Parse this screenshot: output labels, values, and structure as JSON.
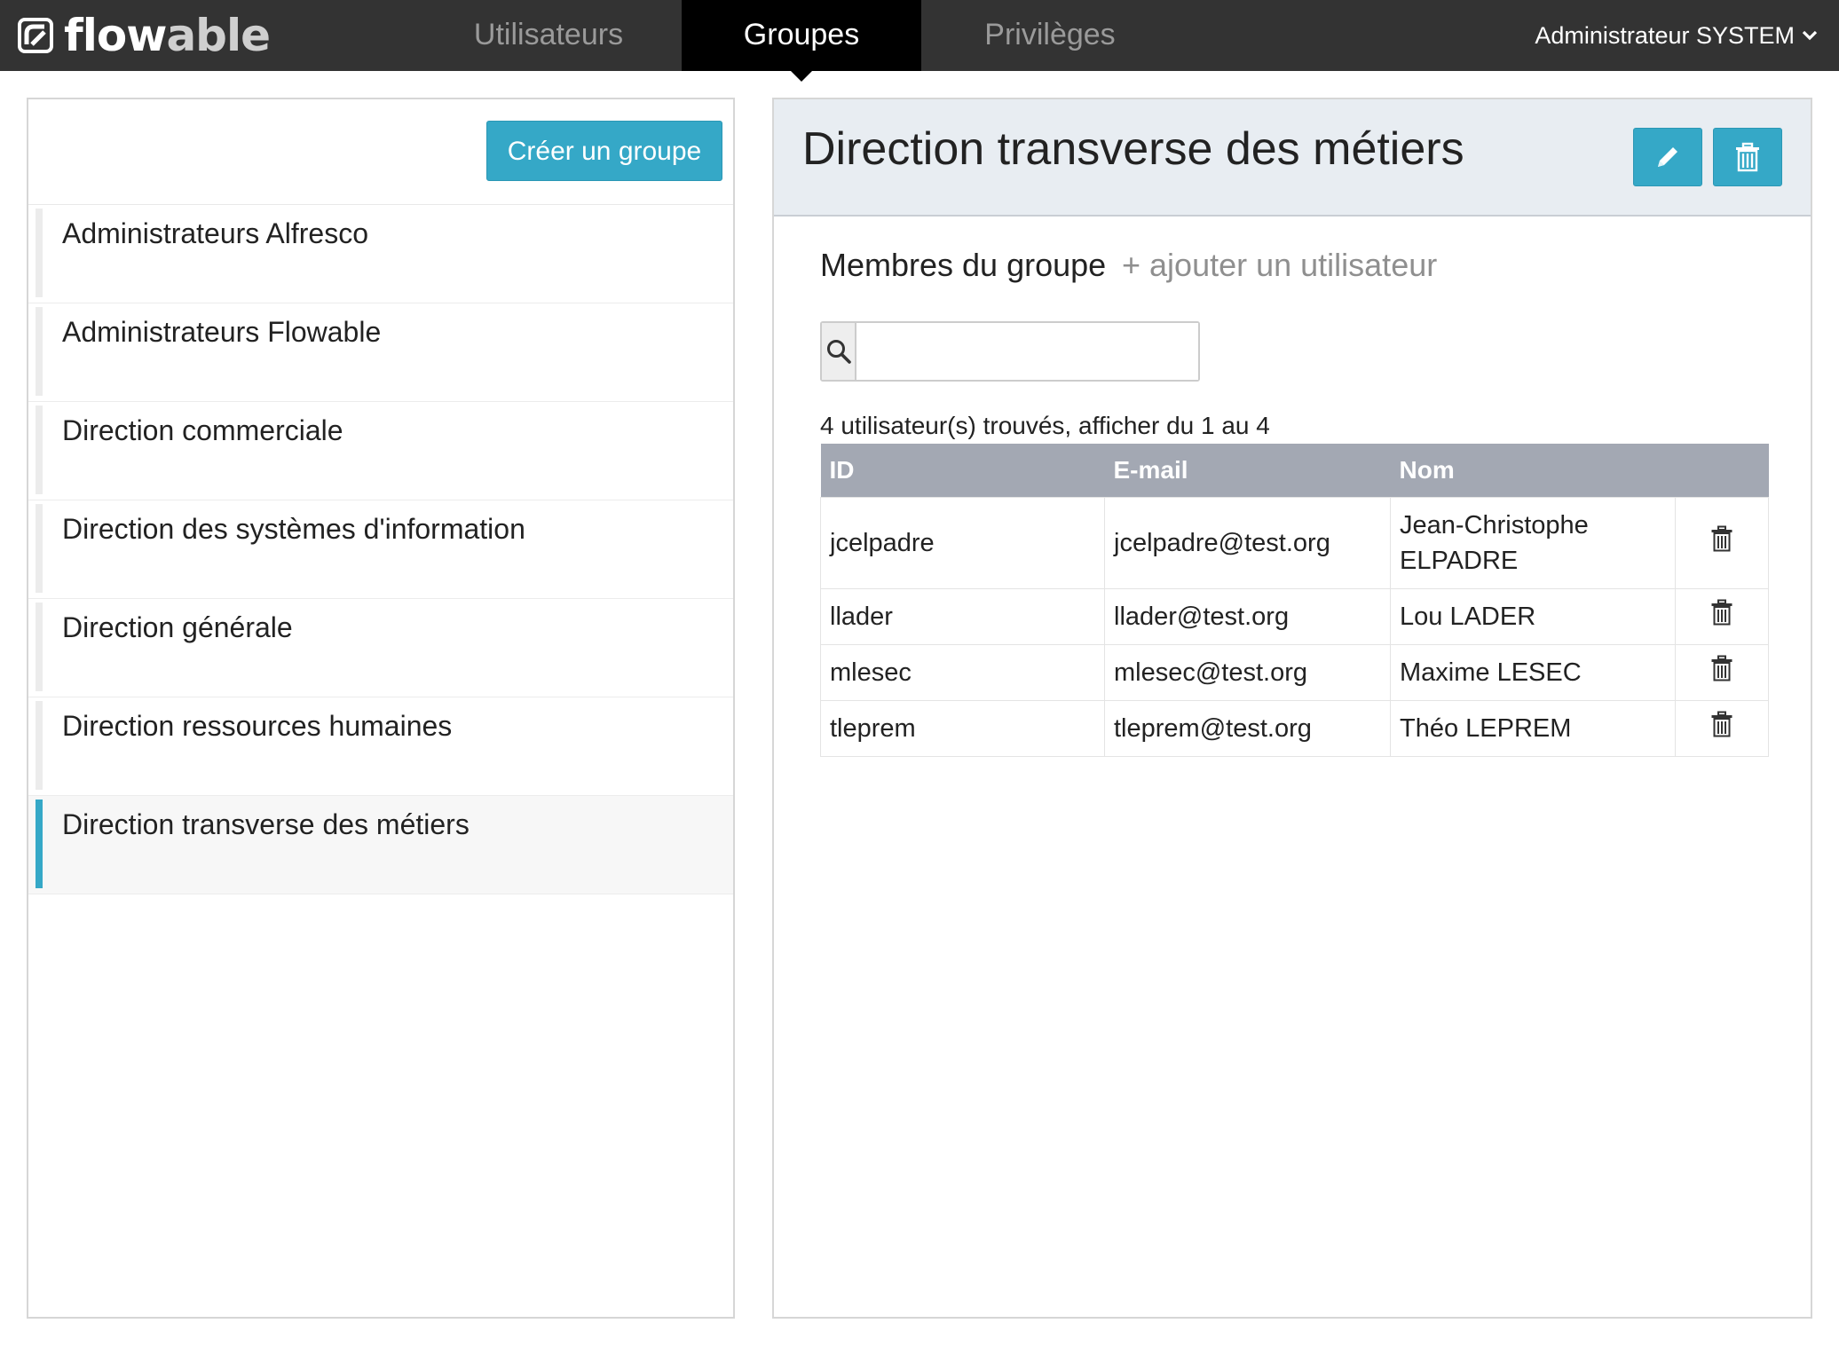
{
  "app": {
    "logo_text": "flowable"
  },
  "nav": {
    "tabs": [
      {
        "label": "Utilisateurs",
        "active": false
      },
      {
        "label": "Groupes",
        "active": true
      },
      {
        "label": "Privilèges",
        "active": false
      }
    ],
    "user_menu_label": "Administrateur SYSTEM"
  },
  "sidebar": {
    "create_button_label": "Créer un groupe",
    "groups": [
      {
        "label": "Administrateurs Alfresco",
        "active": false
      },
      {
        "label": "Administrateurs Flowable",
        "active": false
      },
      {
        "label": "Direction commerciale",
        "active": false
      },
      {
        "label": "Direction des systèmes d'information",
        "active": false
      },
      {
        "label": "Direction générale",
        "active": false
      },
      {
        "label": "Direction ressources humaines",
        "active": false
      },
      {
        "label": "Direction transverse des métiers",
        "active": true
      }
    ]
  },
  "detail": {
    "title": "Direction transverse des métiers",
    "edit_icon": "pencil-icon",
    "delete_icon": "trash-icon",
    "members_heading": "Membres du groupe",
    "add_user_label": "+ ajouter un utilisateur",
    "search": {
      "value": "",
      "icon": "search-icon"
    },
    "result_count": "4 utilisateur(s) trouvés, afficher du 1 au 4",
    "table": {
      "headers": [
        "ID",
        "E-mail",
        "Nom"
      ],
      "rows": [
        {
          "id": "jcelpadre",
          "email": "jcelpadre@test.org",
          "name": "Jean-Christophe ELPADRE"
        },
        {
          "id": "llader",
          "email": "llader@test.org",
          "name": "Lou LADER"
        },
        {
          "id": "mlesec",
          "email": "mlesec@test.org",
          "name": "Maxime LESEC"
        },
        {
          "id": "tleprem",
          "email": "tleprem@test.org",
          "name": "Théo LEPREM"
        }
      ]
    }
  },
  "colors": {
    "navbar": "#333333",
    "nav_active": "#000000",
    "accent": "#35a8c7",
    "header_bg": "#e8edf2",
    "table_header": "#a3a8b3"
  }
}
